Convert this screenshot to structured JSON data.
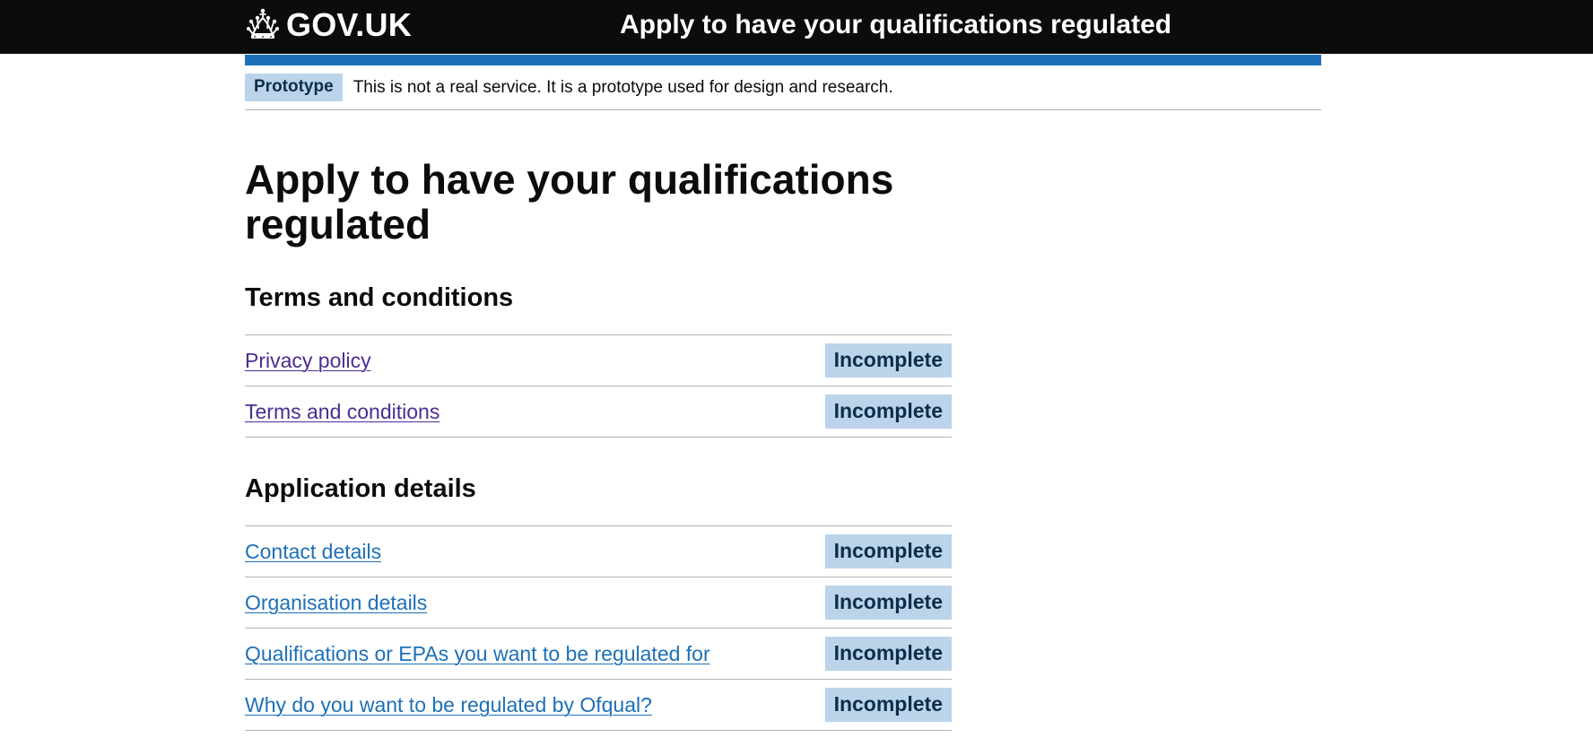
{
  "header": {
    "logo_text": "GOV.UK",
    "service_name": "Apply to have your qualifications regulated"
  },
  "phase_banner": {
    "tag": "Prototype",
    "text": "This is not a real service. It is a prototype used for design and research."
  },
  "page": {
    "title": "Apply to have your qualifications regulated"
  },
  "sections": [
    {
      "heading": "Terms and conditions",
      "tasks": [
        {
          "label": "Privacy policy",
          "status": "Incomplete",
          "visited": true
        },
        {
          "label": "Terms and conditions",
          "status": "Incomplete",
          "visited": true
        }
      ]
    },
    {
      "heading": "Application details",
      "tasks": [
        {
          "label": "Contact details",
          "status": "Incomplete",
          "visited": false
        },
        {
          "label": "Organisation details",
          "status": "Incomplete",
          "visited": false
        },
        {
          "label": "Qualifications or EPAs you want to be regulated for",
          "status": "Incomplete",
          "visited": false
        },
        {
          "label": "Why do you want to be regulated by Ofqual?",
          "status": "Incomplete",
          "visited": false
        }
      ]
    }
  ],
  "colors": {
    "header_bg": "#0b0c0c",
    "brand_blue": "#1d70b8",
    "link_visited": "#4c2c92",
    "tag_bg": "#bbd4ea",
    "tag_text": "#0c2d4a"
  },
  "icons": {
    "logo": "crown-icon"
  }
}
